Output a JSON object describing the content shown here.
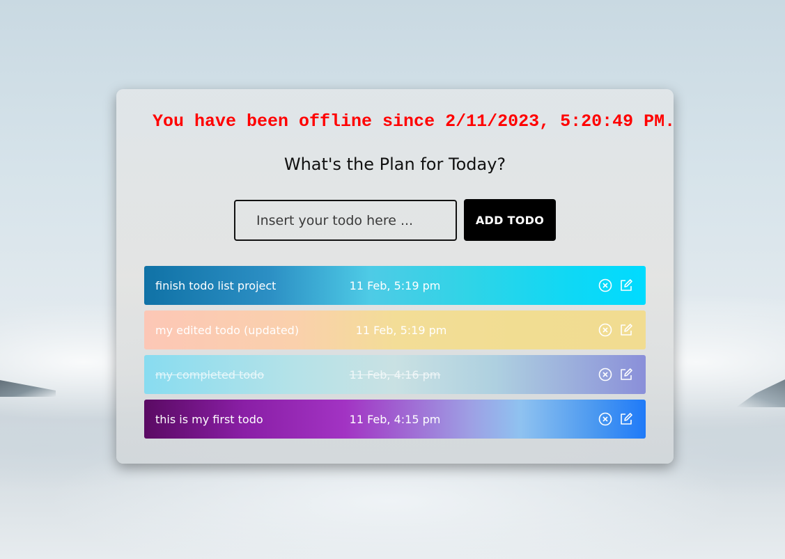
{
  "status": {
    "offline_message": "You have been offline since 2/11/2023, 5:20:49 PM.",
    "icon": "wifi-off-icon",
    "color": "#ff0000"
  },
  "heading": "What's the Plan for Today?",
  "form": {
    "input_value": "",
    "input_placeholder": "Insert your todo here ...",
    "add_button_label": "ADD TODO"
  },
  "todos": [
    {
      "text": "finish todo list project",
      "date": "11 Feb, 5:19 pm",
      "completed": false
    },
    {
      "text": "my edited todo (updated)",
      "date": "11 Feb, 5:19 pm",
      "completed": false
    },
    {
      "text": "my completed todo",
      "date": "11 Feb, 4:16 pm",
      "completed": true
    },
    {
      "text": "this is my first todo",
      "date": "11 Feb, 4:15 pm",
      "completed": false
    }
  ],
  "item_actions": {
    "delete_icon": "close-circle-icon",
    "edit_icon": "edit-icon"
  }
}
